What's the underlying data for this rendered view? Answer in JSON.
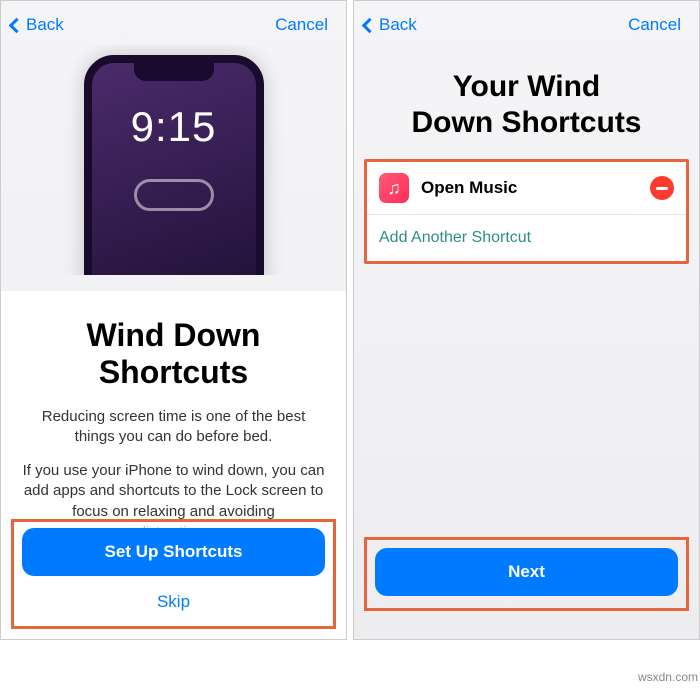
{
  "nav": {
    "back_label": "Back",
    "cancel_label": "Cancel"
  },
  "left": {
    "clock": "9:15",
    "title_line_a": "Wind Down",
    "title_line_b": "Shortcuts",
    "desc1": "Reducing screen time is one of the best things you can do before bed.",
    "desc2": "If you use your iPhone to wind down, you can add apps and shortcuts to the Lock screen to focus on relaxing and avoiding",
    "desc2_fade": "distractions",
    "primary_button": "Set Up Shortcuts",
    "secondary_button": "Skip"
  },
  "right": {
    "title_line_a": "Your Wind",
    "title_line_b": "Down Shortcuts",
    "shortcut_label": "Open Music",
    "add_label": "Add Another Shortcut",
    "primary_button": "Next"
  },
  "watermark": "wsxdn.com"
}
